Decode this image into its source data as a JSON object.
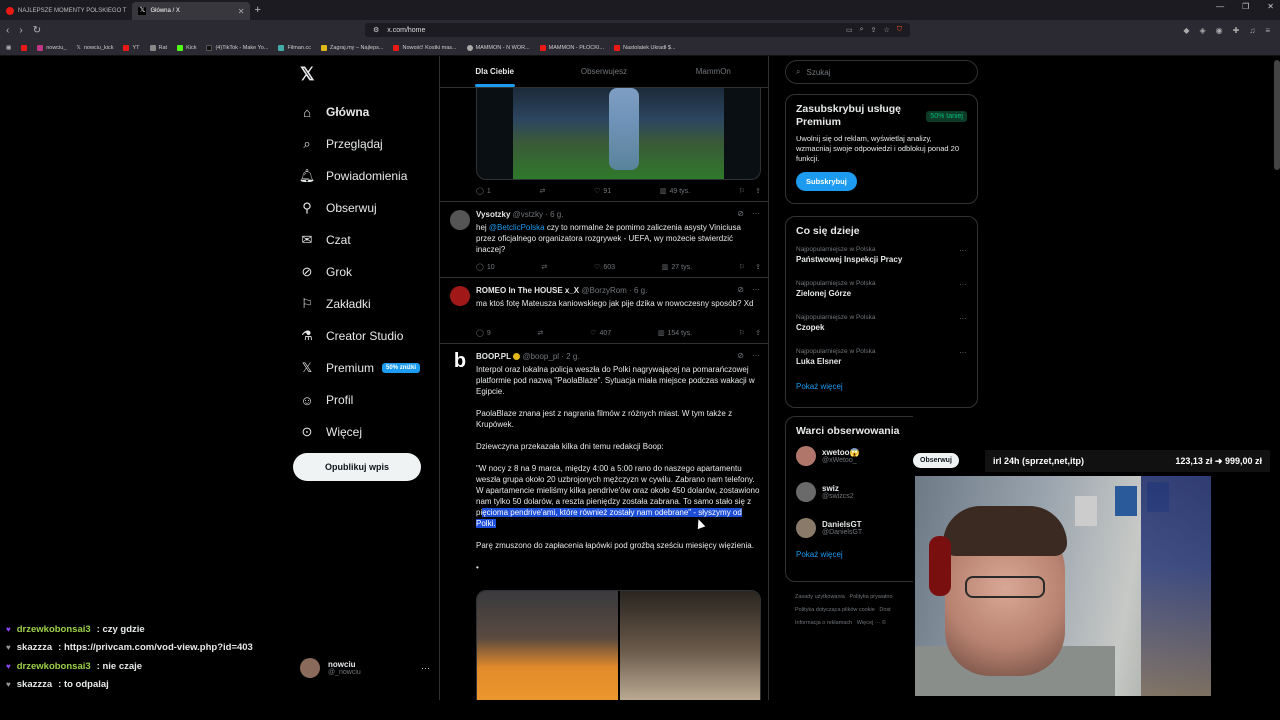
{
  "browser": {
    "tabs": [
      {
        "label": "NAJLEPSZE MOMENTY POLSKIEGO T",
        "active": false
      },
      {
        "label": "Główna / X",
        "active": true
      }
    ],
    "url": "x.com/home",
    "bookmarks": [
      "nowciu_",
      "nowciu_kick",
      "YT",
      "Rat",
      "Kick",
      "(4)TikTok - Make Yo...",
      "Filman.cc",
      "Zagraj.my – Najleps...",
      "Nowość! Kostki mas...",
      "MAMMON - N WOR...",
      "MAMMON - PŁOCKI...",
      "Nastolatek Ukradł $..."
    ]
  },
  "sidebar": {
    "items": [
      {
        "label": "Główna",
        "icon": "home-icon"
      },
      {
        "label": "Przeglądaj",
        "icon": "search-icon"
      },
      {
        "label": "Powiadomienia",
        "icon": "bell-icon"
      },
      {
        "label": "Obserwuj",
        "icon": "add-person-icon"
      },
      {
        "label": "Czat",
        "icon": "mail-icon"
      },
      {
        "label": "Grok",
        "icon": "grok-icon"
      },
      {
        "label": "Zakładki",
        "icon": "bookmark-icon"
      },
      {
        "label": "Creator Studio",
        "icon": "flask-icon"
      },
      {
        "label": "Premium",
        "icon": "x-icon"
      },
      {
        "label": "Profil",
        "icon": "person-icon"
      },
      {
        "label": "Więcej",
        "icon": "more-circle-icon"
      }
    ],
    "premium_badge": "50% zniżki",
    "post_button": "Opublikuj wpis",
    "account": {
      "name": "nowciu",
      "handle": "@_nowciu"
    }
  },
  "feed": {
    "tabs": [
      "Dla Ciebie",
      "Obserwujesz",
      "MammOn"
    ],
    "first_stats": {
      "replies": "1",
      "likes": "91",
      "views": "49 tys."
    },
    "tweets": [
      {
        "name": "Vysotzky",
        "handle": "@vstzky · 6 g.",
        "pre": "hej ",
        "mention": "@BetclicPolska",
        "text": " czy to normalne że pomimo zaliczenia asysty Viniciusa przez oficjalnego organizatora rozgrywek - UEFA, wy możecie stwierdzić inaczej?",
        "replies": "10",
        "likes": "603",
        "views": "27 tys."
      },
      {
        "name": "ROMEO In The HOUSE x_X",
        "handle": "@BorzyRom · 6 g.",
        "text": "ma ktoś fotę Mateusza kaniowskiego jak pije dzika w nowoczesny sposób? Xd",
        "replies": "9",
        "likes": "407",
        "views": "154 tys."
      },
      {
        "name": "BOOP.PL",
        "handle": "@boop_pl · 2 g.",
        "p1": "Interpol oraz lokalna policja weszła do Polki nagrywającej na pomarańczowej platformie pod nazwą \"PaolaBlaze\". Sytuacja miała miejsce podczas wakacji w Egipcie.",
        "p2": "PaolaBlaze znana jest z nagrania filmów z różnych miast. W tym także z Krupówek.",
        "p3": "Dziewczyna przekazała kilka dni temu redakcji Boop:",
        "p4a": "\"W nocy z 8 na 9 marca, między 4:00 a 5:00 rano do naszego apartamentu weszła grupa około 20 uzbrojonych mężczyzn w cywilu. Zabrano nam telefony. W apartamencie mieliśmy kilka pendrive'ów oraz około 450 dolarów, zostawiono nam tylko 50 dolarów, a reszta pieniędzy została zabrana. To samo stało się z pi",
        "p4b": "ęcioma pendrive'ami, które również zostały nam odebrane\" - słyszymy od Polki.",
        "p5": "Parę zmuszono do zapłacenia łapówki pod groźbą sześciu miesięcy więzienia.",
        "p6": "•"
      }
    ]
  },
  "right": {
    "search_placeholder": "Szukaj",
    "premium": {
      "title": "Zasubskrybuj usługę Premium",
      "badge": "50% taniej",
      "text": "Uwolnij się od reklam, wyświetlaj analizy, wzmacniaj swoje odpowiedzi i odblokuj ponad 20 funkcji.",
      "button": "Subskrybuj"
    },
    "trends": {
      "title": "Co się dzieje",
      "items": [
        {
          "cat": "Najpopularniejsze w Polska",
          "name": "Państwowej Inspekcji Pracy"
        },
        {
          "cat": "Najpopularniejsze w Polska",
          "name": "Zielonej Górze"
        },
        {
          "cat": "Najpopularniejsze w Polska",
          "name": "Czopek"
        },
        {
          "cat": "Najpopularniejsze w Polska",
          "name": "Luka Elsner"
        }
      ],
      "more": "Pokaż więcej"
    },
    "who": {
      "title": "Warci obserwowania",
      "items": [
        {
          "name": "xwetoo😱",
          "handle": "@xWetoo_"
        },
        {
          "name": "swiz",
          "handle": "@swizcs2"
        },
        {
          "name": "DanielsGT",
          "handle": "@DanielsGT"
        }
      ],
      "follow": "Obserwuj",
      "more": "Pokaż więcej"
    },
    "footer": [
      "Zasady użytkowania",
      "Polityka prywatno",
      "Polityka dotycząca plików cookie",
      "Dost",
      "Informacja o reklamach",
      "Więcej ···",
      "©"
    ]
  },
  "stream": {
    "goal_label": "irl 24h (sprzet,net,itp)",
    "goal_value": "123,13 zł ➜ 999,00 zł",
    "chat": [
      {
        "user": "drzewkobonsai3",
        "msg": ": czy gdzie",
        "color": "#9bd04a"
      },
      {
        "user": "skazzza",
        "msg": ": https://privcam.com/vod-view.php?id=403",
        "color": "#e7e9ea"
      },
      {
        "user": "drzewkobonsai3",
        "msg": ": nie czaje",
        "color": "#9bd04a"
      },
      {
        "user": "skazzza",
        "msg": ": to odpalaj",
        "color": "#e7e9ea"
      }
    ]
  }
}
